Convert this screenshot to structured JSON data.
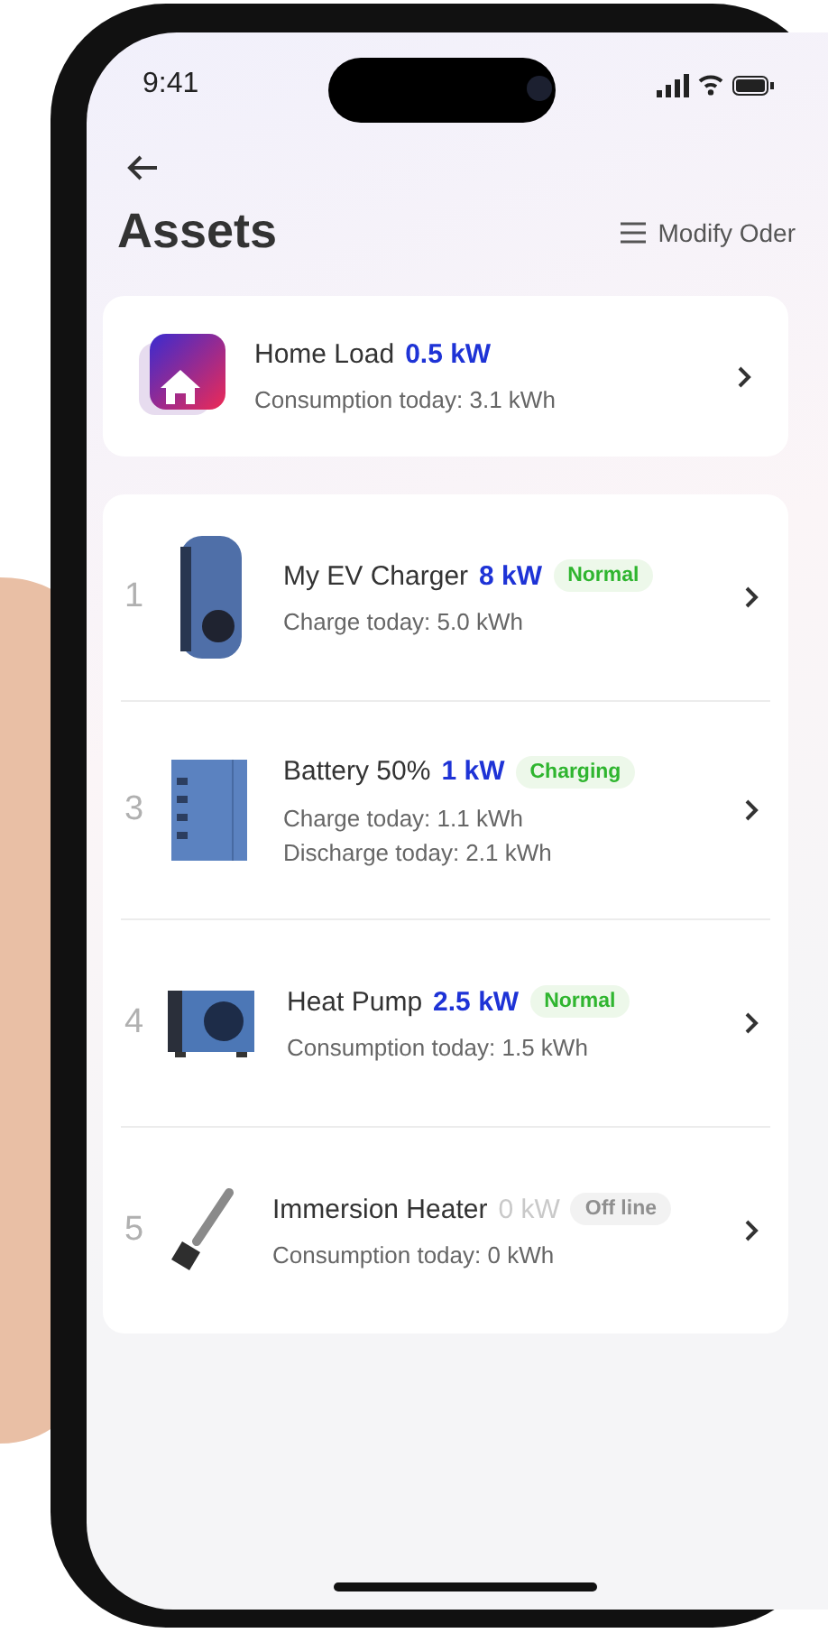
{
  "status_bar": {
    "time": "9:41"
  },
  "header": {
    "title": "Assets",
    "action": "Modify Oder"
  },
  "home_load": {
    "name": "Home Load",
    "power": "0.5 kW",
    "detail": "Consumption today: 3.1 kWh"
  },
  "devices": [
    {
      "index": "1",
      "kind": "ev-charger",
      "name": "My EV Charger",
      "power": "8 kW",
      "status": "Normal",
      "online": true,
      "details": [
        "Charge today: 5.0 kWh"
      ]
    },
    {
      "index": "3",
      "kind": "battery",
      "name": "Battery 50%",
      "power": "1 kW",
      "status": "Charging",
      "online": true,
      "details": [
        "Charge today: 1.1 kWh",
        "Discharge today: 2.1 kWh"
      ]
    },
    {
      "index": "4",
      "kind": "heat-pump",
      "name": "Heat Pump",
      "power": "2.5 kW",
      "status": "Normal",
      "online": true,
      "details": [
        "Consumption today: 1.5 kWh"
      ]
    },
    {
      "index": "5",
      "kind": "heater",
      "name": "Immersion Heater",
      "power": "0 kW",
      "status": "Off line",
      "online": false,
      "details": [
        "Consumption today: 0 kWh"
      ]
    }
  ]
}
